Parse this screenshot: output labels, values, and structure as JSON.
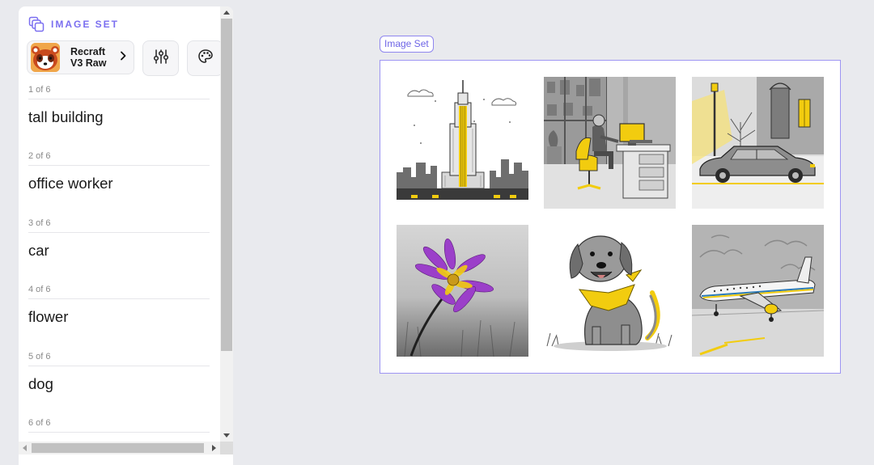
{
  "panel": {
    "title": "IMAGE SET",
    "model": {
      "name": "Recraft V3 Raw"
    },
    "prompts": [
      {
        "counter": "1 of 6",
        "text": "tall building"
      },
      {
        "counter": "2 of 6",
        "text": "office worker"
      },
      {
        "counter": "3 of 6",
        "text": "car"
      },
      {
        "counter": "4 of 6",
        "text": "flower"
      },
      {
        "counter": "5 of 6",
        "text": "dog"
      },
      {
        "counter": "6 of 6",
        "text": ""
      }
    ]
  },
  "canvas": {
    "frame_label": "Image Set",
    "images": [
      {
        "icon": "skyscraper-illustration"
      },
      {
        "icon": "office-worker-illustration"
      },
      {
        "icon": "car-illustration"
      },
      {
        "icon": "flower-photo"
      },
      {
        "icon": "dog-illustration"
      },
      {
        "icon": "airplane-illustration"
      }
    ]
  },
  "colors": {
    "accent": "#7b6ff0",
    "frame_border": "#9d95f2",
    "highlight_yellow": "#f2cc0f",
    "background": "#e9eaee"
  }
}
